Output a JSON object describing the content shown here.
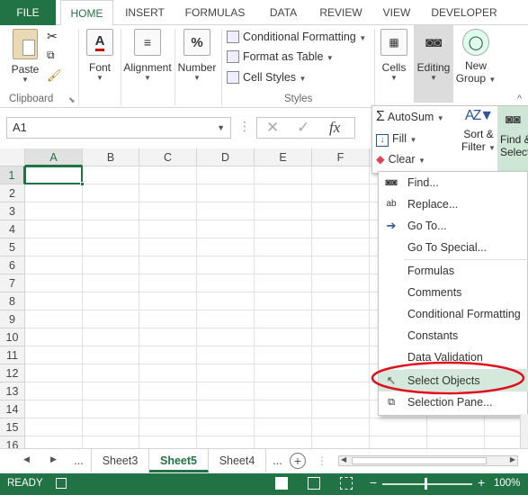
{
  "tabs": [
    "FILE",
    "HOME",
    "INSERT",
    "FORMULAS",
    "DATA",
    "REVIEW",
    "VIEW",
    "DEVELOPER"
  ],
  "ribbon": {
    "paste": "Paste",
    "clipboard": "Clipboard",
    "font": "Font",
    "alignment": "Alignment",
    "number": "Number",
    "conditional_formatting": "Conditional Formatting",
    "format_as_table": "Format as Table",
    "cell_styles": "Cell Styles",
    "styles": "Styles",
    "cells": "Cells",
    "editing": "Editing",
    "new_group_1": "New",
    "new_group_2": "Group",
    "number_icon": "%",
    "font_icon": "A"
  },
  "formula_bar": {
    "name_box": "A1",
    "fx": "fx"
  },
  "columns": [
    "A",
    "B",
    "C",
    "D",
    "E",
    "F"
  ],
  "rows": [
    "1",
    "2",
    "3",
    "4",
    "5",
    "6",
    "7",
    "8",
    "9",
    "10",
    "11",
    "12",
    "13",
    "14",
    "15",
    "16"
  ],
  "editing_panel": {
    "autosum": "AutoSum",
    "fill": "Fill",
    "clear": "Clear",
    "sort_filter_1": "Sort &",
    "sort_filter_2": "Filter",
    "find_select_1": "Find &",
    "find_select_2": "Select"
  },
  "find_menu": [
    "Find...",
    "Replace...",
    "Go To...",
    "Go To Special...",
    "Formulas",
    "Comments",
    "Conditional Formatting",
    "Constants",
    "Data Validation",
    "Select Objects",
    "Selection Pane..."
  ],
  "sheets": {
    "ellipsis": "...",
    "tabs": [
      "Sheet3",
      "Sheet5",
      "Sheet4"
    ],
    "active": "Sheet5",
    "ellipsis2": "..."
  },
  "status": {
    "ready": "READY",
    "zoom": "100%"
  },
  "colors": {
    "accent": "#217346",
    "highlight": "#d4e9dc",
    "annotation": "#e0101c"
  }
}
